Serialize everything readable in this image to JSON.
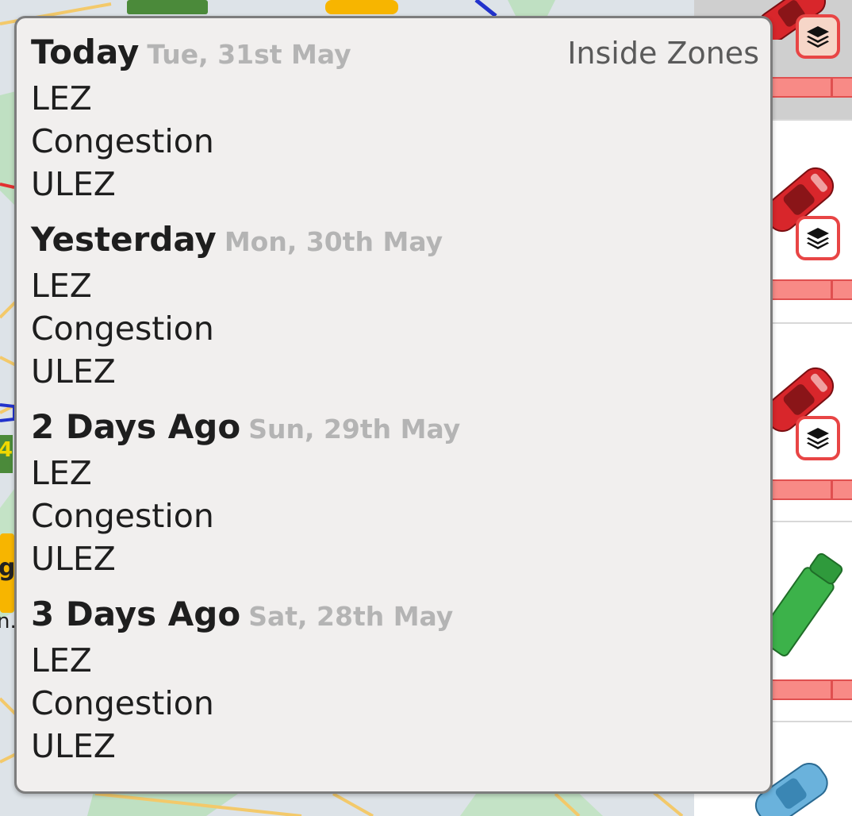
{
  "map": {
    "labels": [
      "4",
      "g",
      "n."
    ]
  },
  "zone_popup": {
    "title": "Inside Zones",
    "days": [
      {
        "name": "Today",
        "date": "Tue, 31st May",
        "zones": [
          "LEZ",
          "Congestion",
          "ULEZ"
        ]
      },
      {
        "name": "Yesterday",
        "date": "Mon, 30th May",
        "zones": [
          "LEZ",
          "Congestion",
          "ULEZ"
        ]
      },
      {
        "name": "2 Days Ago",
        "date": "Sun, 29th May",
        "zones": [
          "LEZ",
          "Congestion",
          "ULEZ"
        ]
      },
      {
        "name": "3 Days Ago",
        "date": "Sat, 28th May",
        "zones": [
          "LEZ",
          "Congestion",
          "ULEZ"
        ]
      }
    ]
  },
  "vehicles": [
    {
      "type": "car",
      "color": "#d8262b",
      "selected": true,
      "layers_icon": "layers-icon"
    },
    {
      "type": "car",
      "color": "#d8262b",
      "selected": false,
      "layers_icon": "layers-icon"
    },
    {
      "type": "car",
      "color": "#d8262b",
      "selected": false,
      "layers_icon": "layers-icon"
    },
    {
      "type": "truck",
      "color": "#3cb24a",
      "selected": false
    },
    {
      "type": "car",
      "color": "#6ab2dc",
      "selected": false
    }
  ],
  "colors": {
    "popup_bg": "#f1efee",
    "status_bar": "#f88a86",
    "layers_border": "#e84545",
    "date_gray": "#b4b4b4"
  }
}
